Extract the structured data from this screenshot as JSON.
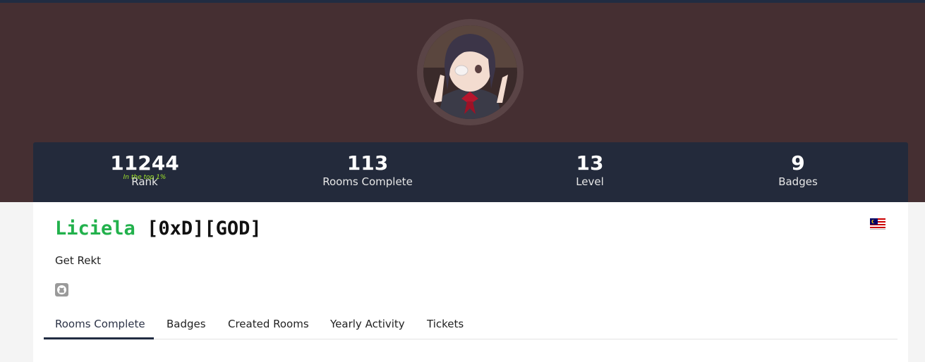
{
  "colors": {
    "banner": "#452f32",
    "stats_bar": "#232a3b",
    "username": "#22b14c",
    "top_percent": "#a3ea2a"
  },
  "stats": {
    "rank": {
      "value": "11244",
      "sub": "In the top 1%",
      "label": "Rank"
    },
    "rooms": {
      "value": "113",
      "label": "Rooms Complete"
    },
    "level": {
      "value": "13",
      "label": "Level"
    },
    "badges": {
      "value": "9",
      "label": "Badges"
    }
  },
  "profile": {
    "username": "Liciela",
    "tags": "[0xD][GOD]",
    "bio": "Get Rekt",
    "flag_icon": "malaysia-flag-icon",
    "social_icon": "github-icon"
  },
  "tabs": [
    {
      "label": "Rooms Complete",
      "active": true
    },
    {
      "label": "Badges"
    },
    {
      "label": "Created Rooms"
    },
    {
      "label": "Yearly Activity"
    },
    {
      "label": "Tickets"
    }
  ]
}
